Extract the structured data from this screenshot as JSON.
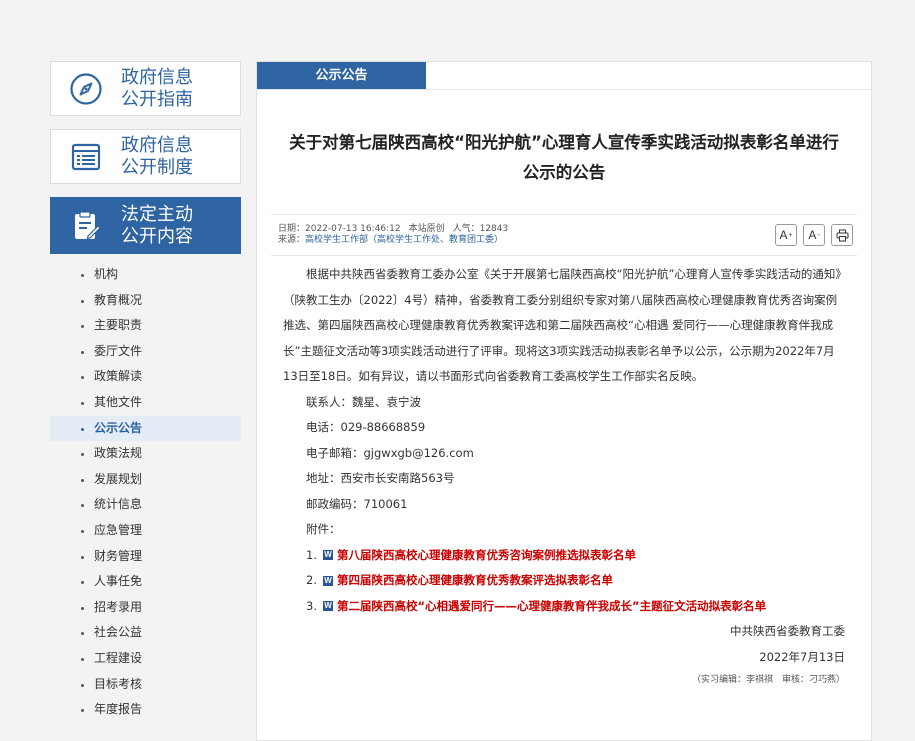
{
  "sidebar": {
    "cards": [
      {
        "line1": "政府信息",
        "line2": "公开指南",
        "icon": "compass-icon"
      },
      {
        "line1": "政府信息",
        "line2": "公开制度",
        "icon": "list-doc-icon"
      },
      {
        "line1": "法定主动",
        "line2": "公开内容",
        "icon": "clipboard-edit-icon"
      }
    ],
    "items": [
      "机构",
      "教育概况",
      "主要职责",
      "委厅文件",
      "政策解读",
      "其他文件",
      "公示公告",
      "政策法规",
      "发展规划",
      "统计信息",
      "应急管理",
      "财务管理",
      "人事任免",
      "招考录用",
      "社会公益",
      "工程建设",
      "目标考核",
      "年度报告"
    ],
    "active_item": "公示公告"
  },
  "main": {
    "tab_label": "公示公告",
    "title_line1": "关于对第七届陕西高校“阳光护航”心理育人宣传季实践活动拟表彰名单进行",
    "title_line2": "公示的公告",
    "meta": {
      "date": "日期：2022-07-13 16:46:12",
      "origin": "本站原创",
      "views": "人气：12843",
      "source_label": "来源：",
      "source_value": "高校学生工作部（高校学生工作处、教育团工委）"
    },
    "tools": {
      "font_up": "A",
      "font_down": "A",
      "print": "print-icon"
    },
    "paragraph": "根据中共陕西省委教育工委办公室《关于开展第七届陕西高校“阳光护航”心理育人宣传季实践活动的通知》（陕教工生办〔2022〕4号）精神，省委教育工委分别组织专家对第八届陕西高校心理健康教育优秀咨询案例推选、第四届陕西高校心理健康教育优秀教案评选和第二届陕西高校“心相遇 爱同行——心理健康教育伴我成长”主题征文活动等3项实践活动进行了评审。现将这3项实践活动拟表彰名单予以公示，公示期为2022年7月13日至18日。如有异议，请以书面形式向省委教育工委高校学生工作部实名反映。",
    "contact": "联系人：魏星、袁宁波",
    "phone": "电话：029-88668859",
    "email": "电子邮箱：gjgwxgb@126.com",
    "address": "地址：西安市长安南路563号",
    "postcode": "邮政编码：710061",
    "attachments_label": "附件：",
    "attachments": [
      {
        "num": "1.",
        "title": "第八届陕西高校心理健康教育优秀咨询案例推选拟表彰名单"
      },
      {
        "num": "2.",
        "title": "第四届陕西高校心理健康教育优秀教案评选拟表彰名单"
      },
      {
        "num": "3.",
        "title": "第二届陕西高校“心相遇爱同行——心理健康教育伴我成长”主题征文活动拟表彰名单"
      }
    ],
    "signature": "中共陕西省委教育工委",
    "sign_date": "2022年7月13日",
    "editor_line": "（实习编辑：李祺祺　审核：刁巧燕）"
  },
  "colors": {
    "brand": "#2e64a1",
    "attachment": "#cc0000"
  }
}
